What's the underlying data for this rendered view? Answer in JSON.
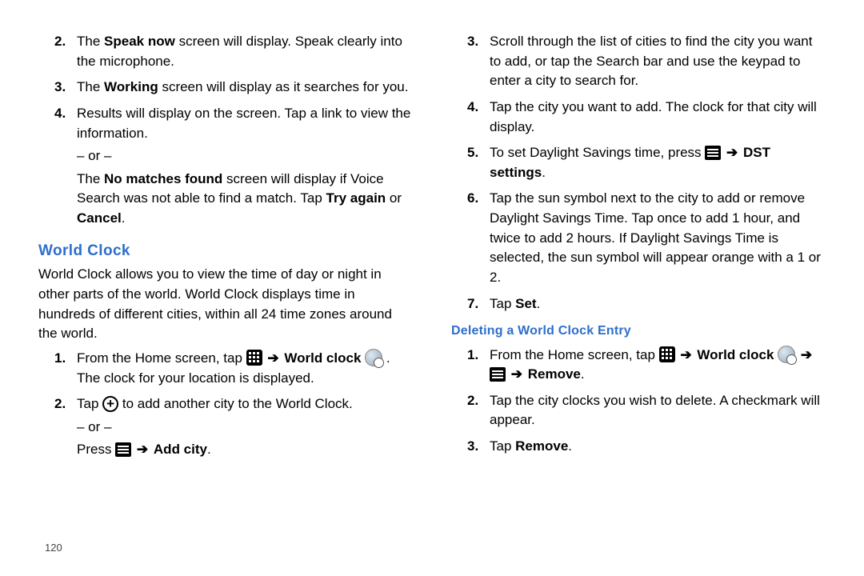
{
  "pageNumber": "120",
  "leftCol": {
    "list1": {
      "items": [
        {
          "num": "2.",
          "pre": "The ",
          "bold1": "Speak now",
          "post1": " screen will display. Speak clearly into the microphone."
        },
        {
          "num": "3.",
          "pre": "The ",
          "bold1": "Working",
          "post1": " screen will display as it searches for you."
        },
        {
          "num": "4.",
          "line": "Results will display on the screen. Tap a link to view the information.",
          "or": "– or –",
          "sub_pre": "The ",
          "sub_bold1": "No matches found",
          "sub_mid1": " screen will display if Voice Search was not able to find a match. Tap ",
          "sub_bold2": "Try again",
          "sub_mid2": " or ",
          "sub_bold3": "Cancel",
          "sub_end": "."
        }
      ]
    },
    "heading": "World Clock",
    "paragraph": "World Clock allows you to view the time of day or night in other parts of the world. World Clock displays time in hundreds of different cities, within all 24 time zones around the world.",
    "list2": {
      "items": [
        {
          "num": "1.",
          "pre": "From the Home screen, tap ",
          "bold1": " World clock ",
          "post1": ". The clock for your location is displayed."
        },
        {
          "num": "2.",
          "pre": "Tap ",
          "post": "  to add another city to the World Clock.",
          "or": "– or –",
          "press_pre": "Press ",
          "press_bold": " Add city",
          "press_end": "."
        }
      ]
    }
  },
  "rightCol": {
    "list1": {
      "items": [
        {
          "num": "3.",
          "text": "Scroll through the list of cities to find the city you want to add, or tap the Search bar and use the keypad to enter a city to search for."
        },
        {
          "num": "4.",
          "text": "Tap the city you want to add. The clock for that city will display."
        },
        {
          "num": "5.",
          "pre": "To set Daylight Savings time, press ",
          "bold1": " DST settings",
          "end": "."
        },
        {
          "num": "6.",
          "text": "Tap the sun symbol next to the city to add or remove Daylight Savings Time. Tap once to add 1 hour, and twice to add 2 hours. If Daylight Savings Time is selected, the sun symbol will appear orange with a 1 or 2."
        },
        {
          "num": "7.",
          "pre": "Tap ",
          "bold1": "Set",
          "end": "."
        }
      ]
    },
    "subheading": "Deleting a World Clock Entry",
    "list2": {
      "items": [
        {
          "num": "1.",
          "pre": "From the Home screen, tap ",
          "bold1": " World clock ",
          "bold2": " Remove",
          "end": "."
        },
        {
          "num": "2.",
          "text": "Tap the city clocks you wish to delete. A checkmark will appear."
        },
        {
          "num": "3.",
          "pre": "Tap ",
          "bold1": "Remove",
          "end": "."
        }
      ]
    }
  }
}
